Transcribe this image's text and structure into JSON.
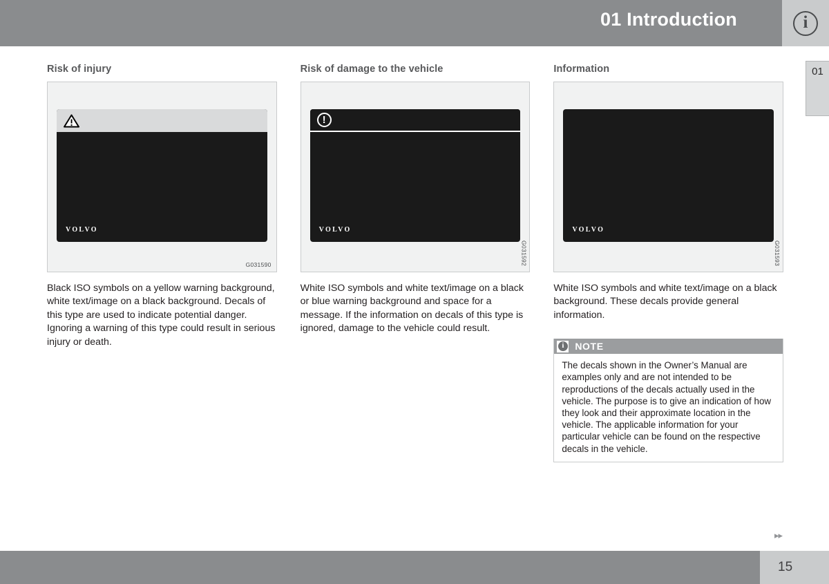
{
  "header": {
    "title": "01 Introduction",
    "info_icon_glyph": "i",
    "chapter_tab": "01"
  },
  "columns": [
    {
      "heading": "Risk of injury",
      "figure": {
        "code": "G031590",
        "decal_style": "light-strip-warning-triangle",
        "logo": "VOLVO",
        "icon": "warning-triangle-icon"
      },
      "text": "Black ISO symbols on a yellow warning background, white text/image on a black background. Decals of this type are used to indicate potential danger. Ignoring a warning of this type could result in serious injury or death."
    },
    {
      "heading": "Risk of damage to the vehicle",
      "figure": {
        "code": "G031592",
        "decal_style": "dark-header-exclamation-circle",
        "logo": "VOLVO",
        "icon": "exclamation-circle-icon"
      },
      "text": "White ISO symbols and white text/image on a black or blue warning background and space for a message. If the information on decals of this type is ignored, damage to the vehicle could result."
    },
    {
      "heading": "Information",
      "figure": {
        "code": "G031593",
        "decal_style": "plain-black",
        "logo": "VOLVO",
        "icon": "none"
      },
      "text": "White ISO symbols and white text/image on a black background. These decals provide general information."
    }
  ],
  "note": {
    "title": "NOTE",
    "icon_glyph": "i",
    "body": "The decals shown in the Owner’s Manual are examples only and are not intended to be reproductions of the decals actually used in the vehicle. The purpose is to give an indication of how they look and their approximate location in the vehicle. The applicable information for your particular vehicle can be found on the respective decals in the vehicle."
  },
  "footer": {
    "nav_arrows": "▸▸",
    "page_number": "15"
  },
  "colors": {
    "header_bar": "#8a8c8e",
    "header_icon_box": "#c9cbcc",
    "figure_bg": "#f1f2f2",
    "decal_black": "#1a1a1a",
    "note_header": "#9b9d9f",
    "heading_text": "#58595b"
  }
}
